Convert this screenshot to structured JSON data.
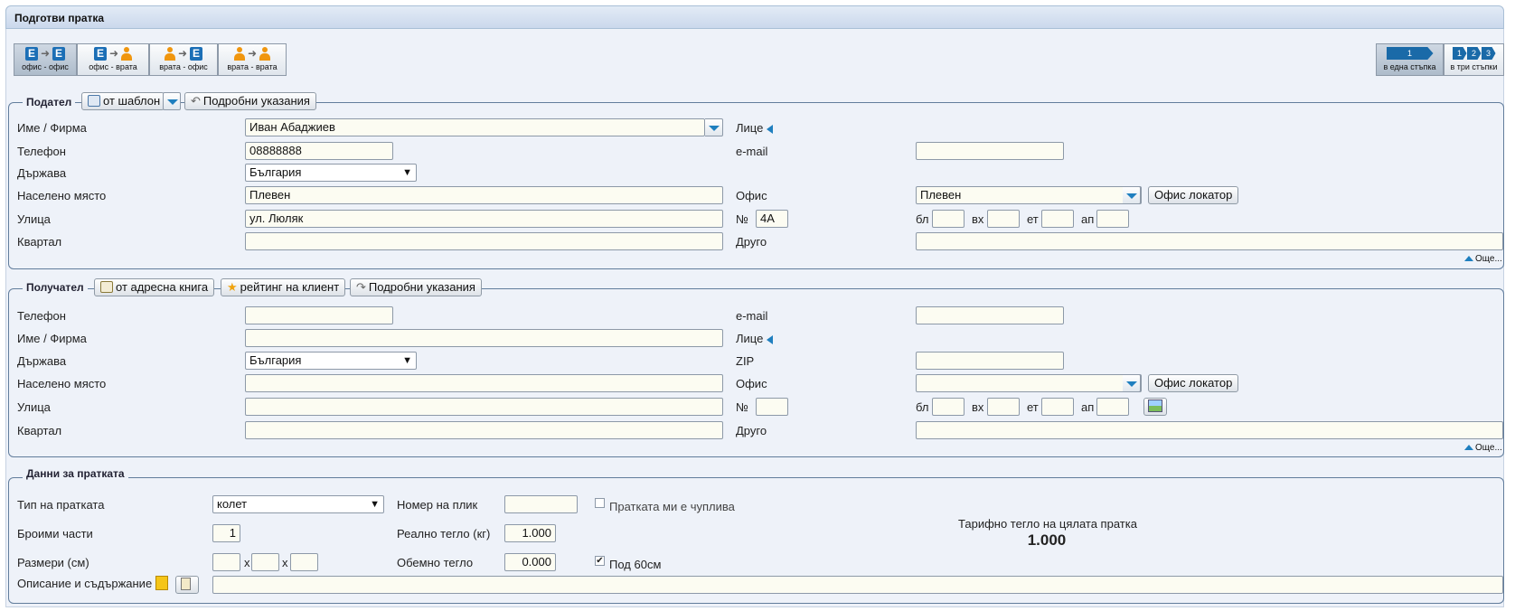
{
  "title": "Подготви пратка",
  "modes": [
    {
      "label": "офис - офис",
      "from": "office-icon",
      "to": "office-icon"
    },
    {
      "label": "офис - врата",
      "from": "office-icon",
      "to": "person-icon"
    },
    {
      "label": "врата - офис",
      "from": "person-icon",
      "to": "office-icon"
    },
    {
      "label": "врата - врата",
      "from": "person-icon",
      "to": "person-icon"
    }
  ],
  "steps": {
    "one_label": "в една стъпка",
    "three_label": "в три стъпки",
    "one_badge": "1",
    "three_badges": [
      "1",
      "2",
      "3"
    ]
  },
  "sender": {
    "legend": "Подател",
    "template_button": "от шаблон",
    "directions_button": "Подробни указания",
    "name_label": "Име / Фирма",
    "name_value": "Иван Абаджиев",
    "person_label": "Лице",
    "phone_label": "Телефон",
    "phone_value": "08888888",
    "email_label": "e-mail",
    "email_value": "",
    "country_label": "Държава",
    "country_value": "България",
    "city_label": "Населено място",
    "city_value": "Плевен",
    "office_label": "Офис",
    "office_value": "Плевен",
    "office_locator_button": "Офис локатор",
    "street_label": "Улица",
    "street_value": "ул. Люляк",
    "number_label": "№",
    "number_value": "4А",
    "block_label": "бл",
    "entrance_label": "вх",
    "floor_label": "ет",
    "apartment_label": "ап",
    "district_label": "Квартал",
    "other_label": "Друго",
    "more_link": "Още..."
  },
  "receiver": {
    "legend": "Получател",
    "address_book_button": "от адресна книга",
    "rating_button": "рейтинг на клиент",
    "directions_button": "Подробни указания",
    "phone_label": "Телефон",
    "email_label": "e-mail",
    "name_label": "Име / Фирма",
    "person_label": "Лице",
    "country_label": "Държава",
    "country_value": "България",
    "zip_label": "ZIP",
    "city_label": "Населено място",
    "office_label": "Офис",
    "office_value": "",
    "office_locator_button": "Офис локатор",
    "street_label": "Улица",
    "number_label": "№",
    "block_label": "бл",
    "entrance_label": "вх",
    "floor_label": "ет",
    "apartment_label": "ап",
    "district_label": "Квартал",
    "other_label": "Друго",
    "more_link": "Още..."
  },
  "shipment": {
    "legend": "Данни за пратката",
    "type_label": "Тип на пратката",
    "type_value": "колет",
    "envelope_label": "Номер на плик",
    "envelope_value": "",
    "fragile_label": "Пратката ми е чуплива",
    "fragile_checked": false,
    "parts_label": "Броими части",
    "parts_value": "1",
    "real_weight_label": "Реално тегло (кг)",
    "real_weight_value": "1.000",
    "tariff_label": "Тарифно тегло на цялата пратка",
    "tariff_value": "1.000",
    "dimensions_label": "Размери (см)",
    "dim_separator": "x",
    "volume_weight_label": "Обемно тегло",
    "volume_weight_value": "0.000",
    "under60_label": "Под 60см",
    "under60_checked": true,
    "description_label": "Описание и съдържание"
  },
  "colors": {
    "accent": "#1f7fbf",
    "person": "#f0960e",
    "field_bg": "#fcfcf2",
    "panel_bg": "#eef2f9"
  }
}
